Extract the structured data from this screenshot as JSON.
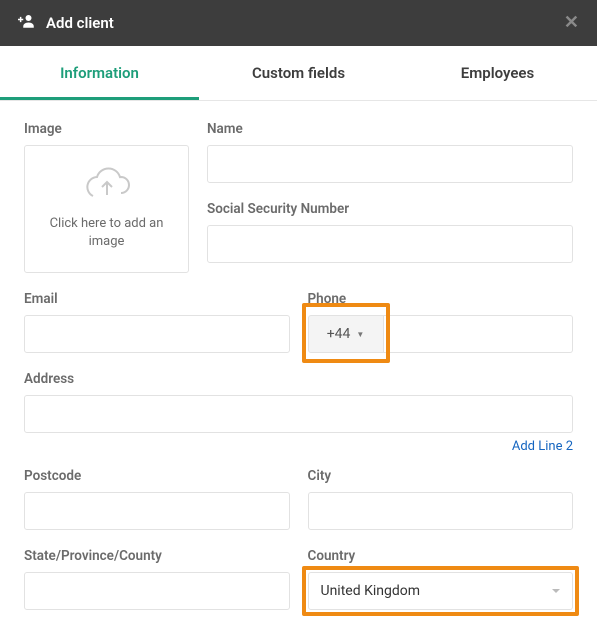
{
  "header": {
    "title": "Add client"
  },
  "tabs": [
    {
      "label": "Information",
      "active": true
    },
    {
      "label": "Custom fields",
      "active": false
    },
    {
      "label": "Employees",
      "active": false
    }
  ],
  "form": {
    "image": {
      "label": "Image",
      "placeholder_text": "Click here to add an image"
    },
    "name": {
      "label": "Name",
      "value": ""
    },
    "ssn": {
      "label": "Social Security Number",
      "value": ""
    },
    "email": {
      "label": "Email",
      "value": ""
    },
    "phone": {
      "label": "Phone",
      "prefix": "+44",
      "value": ""
    },
    "address": {
      "label": "Address",
      "value": "",
      "add_line_label": "Add Line 2"
    },
    "postcode": {
      "label": "Postcode",
      "value": ""
    },
    "city": {
      "label": "City",
      "value": ""
    },
    "state": {
      "label": "State/Province/County",
      "value": ""
    },
    "country": {
      "label": "Country",
      "selected": "United Kingdom"
    }
  }
}
